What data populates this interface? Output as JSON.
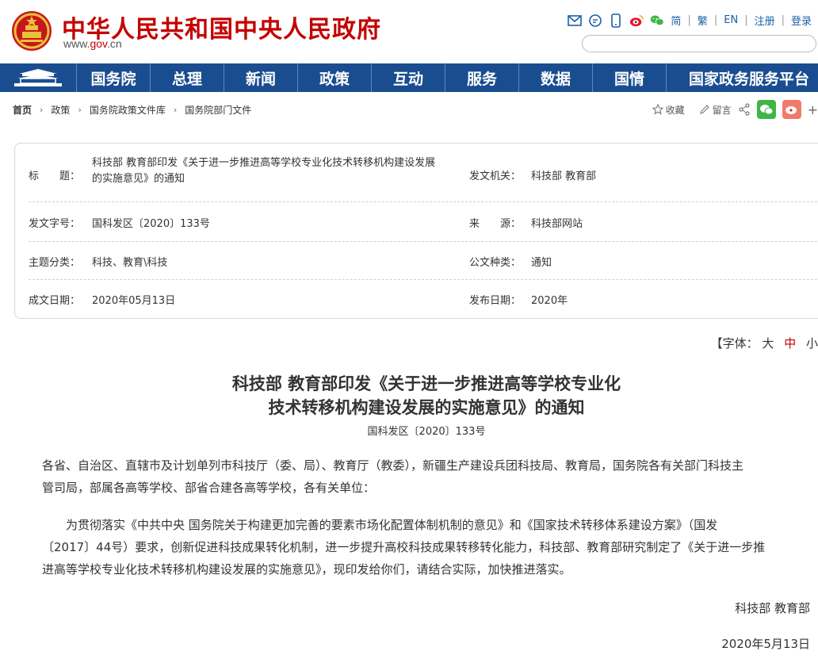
{
  "header": {
    "site_title": "中华人民共和国中央人民政府",
    "site_url_prefix": "www.",
    "site_url_gov": "gov",
    "site_url_suffix": ".cn",
    "lang_simplified": "简",
    "lang_traditional": "繁",
    "lang_en": "EN",
    "register": "注册",
    "login": "登录",
    "search_placeholder": ""
  },
  "nav": {
    "items": [
      "国务院",
      "总理",
      "新闻",
      "政策",
      "互动",
      "服务",
      "数据",
      "国情",
      "国家政务服务平台"
    ]
  },
  "breadcrumb": {
    "items": [
      "首页",
      "政策",
      "国务院政策文件库",
      "国务院部门文件"
    ]
  },
  "share": {
    "favorite": "收藏",
    "comment": "留言",
    "more": "+"
  },
  "info": {
    "title_label": "标　　题：",
    "title_value_line1": "科技部 教育部印发《关于进一步推进高等学校专业化技术转移机构建设发展",
    "title_value_line2": "的实施意见》的通知",
    "issuer_label": "发文机关：",
    "issuer_value": "科技部 教育部",
    "docno_label": "发文字号：",
    "docno_value": "国科发区〔2020〕133号",
    "source_label": "来　　源：",
    "source_value": "科技部网站",
    "topic_label": "主题分类：",
    "topic_value": "科技、教育\\科技",
    "type_label": "公文种类：",
    "type_value": "通知",
    "written_label": "成文日期：",
    "written_value": "2020年05月13日",
    "published_label": "发布日期：",
    "published_value": "2020年"
  },
  "fontsize": {
    "prefix": "【字体：",
    "large": "大",
    "medium": "中",
    "small": "小"
  },
  "article": {
    "title_line1": "科技部 教育部印发《关于进一步推进高等学校专业化",
    "title_line2": "技术转移机构建设发展的实施意见》的通知",
    "doc_no": "国科发区〔2020〕133号",
    "para1_line1": "各省、自治区、直辖市及计划单列市科技厅（委、局）、教育厅（教委），新疆生产建设兵团科技局、教育局，国务院各有关部门科技主",
    "para1_line2": "管司局，部属各高等学校、部省合建各高等学校，各有关单位：",
    "para2_line1": "为贯彻落实《中共中央 国务院关于构建更加完善的要素市场化配置体制机制的意见》和《国家技术转移体系建设方案》（国发",
    "para2_line2": "〔2017〕44号）要求，创新促进科技成果转化机制，进一步提升高校科技成果转移转化能力，科技部、教育部研究制定了《关于进一步推",
    "para2_line3": "进高等学校专业化技术转移机构建设发展的实施意见》，现印发给你们，请结合实际，加快推进落实。",
    "sign_org": "科技部 教育部",
    "sign_date": "2020年5月13日"
  }
}
